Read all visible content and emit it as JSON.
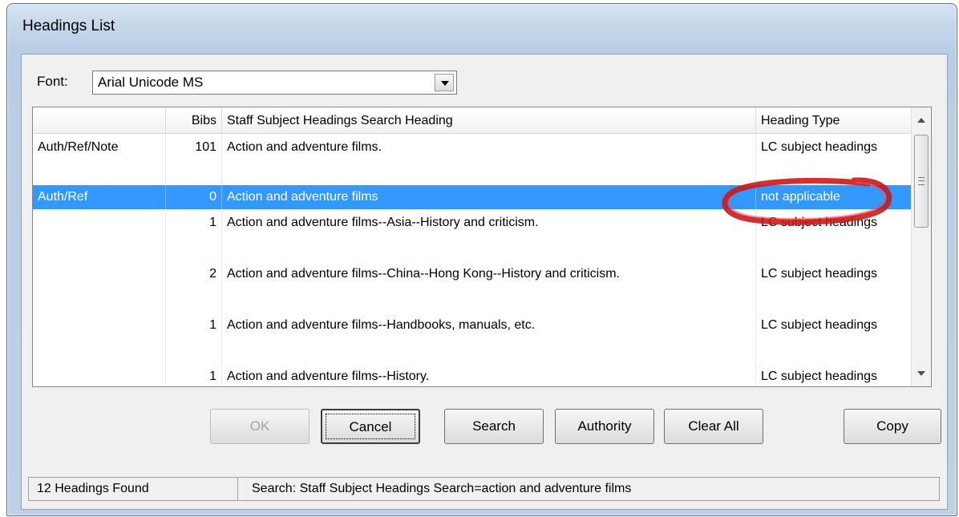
{
  "window": {
    "title": "Headings List"
  },
  "font": {
    "label": "Font:",
    "value": "Arial Unicode MS"
  },
  "grid": {
    "columns": [
      "",
      "Bibs",
      "Staff Subject Headings Search Heading",
      "Heading Type"
    ],
    "rows": [
      {
        "type": "Auth/Ref/Note",
        "bibs": "101",
        "heading": "Action and adventure films.",
        "htype": "LC subject headings"
      },
      {
        "type": "Auth/Ref",
        "bibs": "0",
        "heading": "Action and adventure films",
        "htype": "not applicable"
      },
      {
        "type": "",
        "bibs": "1",
        "heading": "Action and adventure films--Asia--History and criticism.",
        "htype": "LC subject headings"
      },
      {
        "type": "",
        "bibs": "2",
        "heading": "Action and adventure films--China--Hong Kong--History and criticism.",
        "htype": "LC subject headings"
      },
      {
        "type": "",
        "bibs": "1",
        "heading": "Action and adventure films--Handbooks, manuals, etc.",
        "htype": "LC subject headings"
      },
      {
        "type": "",
        "bibs": "1",
        "heading": "Action and adventure films--History.",
        "htype": "LC subject headings"
      }
    ]
  },
  "buttons": {
    "ok": "OK",
    "cancel": "Cancel",
    "search": "Search",
    "authority": "Authority",
    "clear_all": "Clear All",
    "copy": "Copy"
  },
  "status": {
    "found": "12 Headings Found",
    "search": "Search: Staff Subject Headings Search=action and adventure films"
  },
  "colors": {
    "selection": "#3399ff",
    "annotation": "#cc1a1a"
  }
}
